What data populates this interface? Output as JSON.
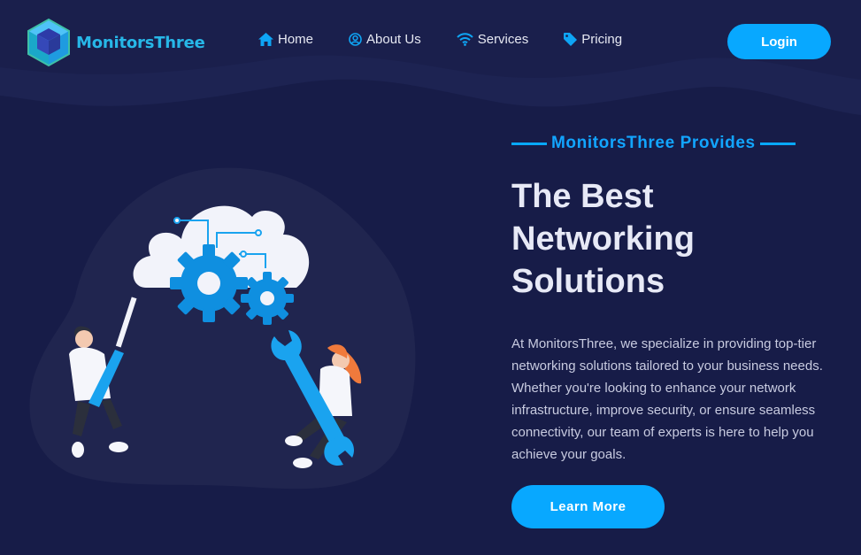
{
  "brand": {
    "name": "MonitorsThree",
    "color": "#27b7e8"
  },
  "nav": {
    "items": [
      {
        "label": "Home",
        "icon": "home-icon"
      },
      {
        "label": "About Us",
        "icon": "user-circle-icon"
      },
      {
        "label": "Services",
        "icon": "wifi-icon"
      },
      {
        "label": "Pricing",
        "icon": "tag-icon"
      }
    ],
    "login_label": "Login"
  },
  "hero": {
    "eyebrow": "MonitorsThree Provides",
    "headline": "The Best Networking Solutions",
    "description": "At MonitorsThree, we specialize in providing top-tier networking solutions tailored to your business needs. Whether you're looking to enhance your network infrastructure, improve security, or ensure seamless connectivity, our team of experts is here to help you achieve your goals.",
    "cta_label": "Learn More"
  },
  "colors": {
    "background": "#171c48",
    "accent": "#08a8ff",
    "blob": "#20254f"
  }
}
